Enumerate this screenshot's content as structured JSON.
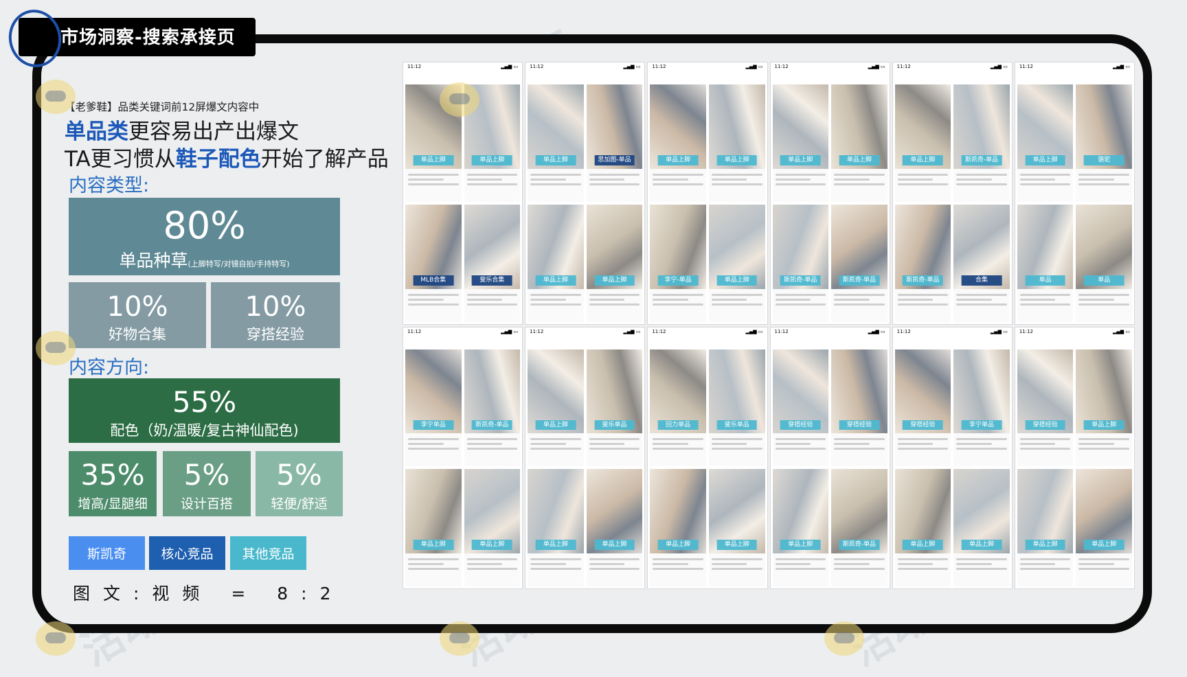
{
  "title": "市场洞察-搜索承接页",
  "caption": "【老爹鞋】品类关键词前12屏爆文内容中",
  "headline": {
    "line1_em": "单品类",
    "line1_rest": "更容易出产出爆文",
    "line2_pre": "TA更习惯从",
    "line2_em": "鞋子配色",
    "line2_rest": "开始了解产品"
  },
  "content_type": {
    "label": "内容类型:",
    "main": {
      "pct": "80%",
      "label": "单品种草",
      "sub": "(上脚特写/对镜自拍/手持特写)"
    },
    "b": {
      "pct": "10%",
      "label": "好物合集"
    },
    "c": {
      "pct": "10%",
      "label": "穿搭经验"
    }
  },
  "content_direction": {
    "label": "内容方向:",
    "main": {
      "pct": "55%",
      "label": "配色（奶/温暖/复古神仙配色)"
    },
    "b": {
      "pct": "35%",
      "label": "增高/显腿细"
    },
    "c": {
      "pct": "5%",
      "label": "设计百搭"
    },
    "d": {
      "pct": "5%",
      "label": "轻便/舒适"
    }
  },
  "buttons": [
    "斯凯奇",
    "核心竞品",
    "其他竞品"
  ],
  "ratio": "图文:视频 = 8:2",
  "watermark": "活动汪",
  "screens": [
    {
      "time": "11:12",
      "tags": [
        "单品上脚",
        "单品上脚",
        "MLB合集",
        "斐乐合集"
      ]
    },
    {
      "time": "11:12",
      "tags": [
        "单品上脚",
        "思加图-单品",
        "单品上脚",
        "单品上脚"
      ]
    },
    {
      "time": "11:12",
      "tags": [
        "单品上脚",
        "单品上脚",
        "李宁-单品",
        "单品上脚"
      ]
    },
    {
      "time": "11:12",
      "tags": [
        "单品上脚",
        "单品上脚",
        "斯凯奇-单品",
        "斯凯奇-单品"
      ]
    },
    {
      "time": "11:12",
      "tags": [
        "单品上脚",
        "斯凯奇-单品",
        "斯凯奇-单品",
        "合集"
      ]
    },
    {
      "time": "11:12",
      "tags": [
        "单品上脚",
        "骆驼",
        "单品",
        "单品"
      ]
    },
    {
      "time": "11:12",
      "tags": [
        "李宁单品",
        "斯凯奇-单品",
        "单品上脚",
        "单品上脚"
      ]
    },
    {
      "time": "11:12",
      "tags": [
        "单品上脚",
        "斐乐单品",
        "单品上脚",
        "单品上脚"
      ]
    },
    {
      "time": "11:12",
      "tags": [
        "回力单品",
        "斐乐单品",
        "单品上脚",
        "单品上脚"
      ]
    },
    {
      "time": "11:12",
      "tags": [
        "穿搭经验",
        "穿搭经验",
        "单品上脚",
        "斯凯奇-单品"
      ]
    },
    {
      "time": "11:12",
      "tags": [
        "穿搭经验",
        "李宁单品",
        "单品上脚",
        "单品上脚"
      ]
    },
    {
      "time": "11:12",
      "tags": [
        "穿搭经验",
        "单品上脚",
        "单品上脚",
        "单品上脚"
      ]
    }
  ],
  "colors": {
    "accent_blue": "#1b58b8",
    "teal_main": "#5f8a95",
    "green_main": "#2c6d45"
  }
}
